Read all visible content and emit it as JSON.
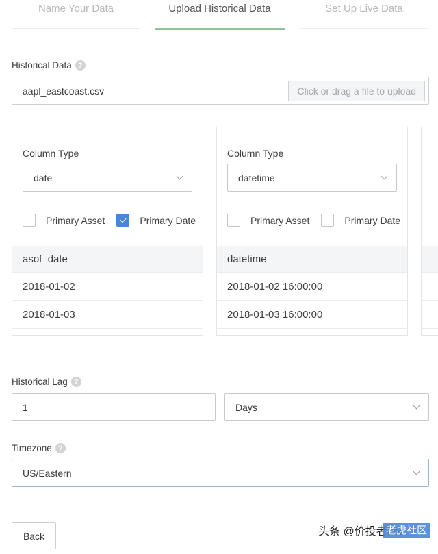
{
  "steps": [
    {
      "label": "Name Your Data",
      "active": false
    },
    {
      "label": "Upload Historical Data",
      "active": true
    },
    {
      "label": "Set Up Live Data",
      "active": false
    }
  ],
  "historical_data": {
    "label": "Historical Data",
    "help_icon": "question-circle-icon",
    "filename": "aapl_eastcoast.csv",
    "upload_button": "Click or drag a file to upload"
  },
  "columns": [
    {
      "type_label": "Column Type",
      "type_value": "date",
      "primary_asset_label": "Primary Asset",
      "primary_asset_checked": false,
      "primary_date_label": "Primary Date",
      "primary_date_checked": true,
      "header": "asof_date",
      "rows": [
        "2018-01-02",
        "2018-01-03"
      ]
    },
    {
      "type_label": "Column Type",
      "type_value": "datetime",
      "primary_asset_label": "Primary Asset",
      "primary_asset_checked": false,
      "primary_date_label": "Primary Date",
      "primary_date_checked": false,
      "header": "datetime",
      "rows": [
        "2018-01-02 16:00:00",
        "2018-01-03 16:00:00"
      ]
    }
  ],
  "historical_lag": {
    "label": "Historical Lag",
    "value": "1",
    "unit": "Days"
  },
  "timezone": {
    "label": "Timezone",
    "value": "US/Eastern"
  },
  "footer": {
    "back_button": "Back"
  },
  "watermark": {
    "text": "头条 @价投者Lbf",
    "badge": "老虎社区"
  },
  "colors": {
    "active_step": "#8cc593",
    "checkbox_checked": "#4a86d8"
  }
}
